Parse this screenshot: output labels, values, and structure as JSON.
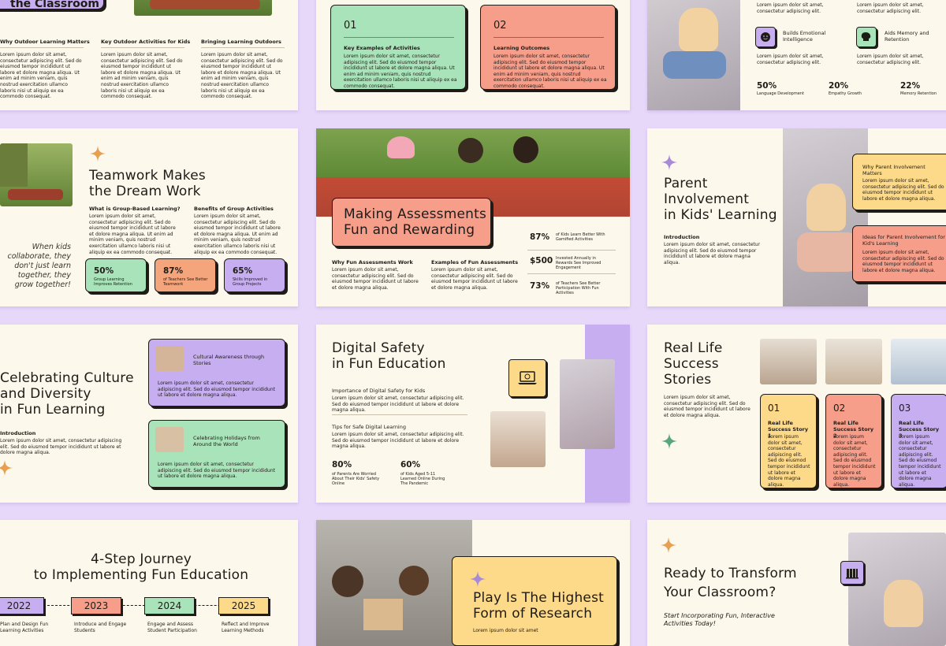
{
  "colors": {
    "purple": "#c6aef0",
    "green": "#a9e3ba",
    "salmon": "#f79e8b",
    "orange": "#f5a57b",
    "yellow": "#fdd98a",
    "cream": "#fcf8ec",
    "bg": "#e7d8fa"
  },
  "icons": [
    "sparkle-icon",
    "laptop-icon",
    "smile-icon",
    "brain-icon",
    "books-icon"
  ],
  "s1": {
    "title": "the Classroom",
    "cols": [
      {
        "h": "Why Outdoor Learning Matters",
        "b": "Lorem ipsum dolor sit amet, consectetur adipiscing elit. Sed do eiusmod tempor incididunt ut labore et dolore magna aliqua. Ut enim ad minim veniam, quis nostrud exercitation ullamco laboris nisi ut aliquip ex ea commodo consequat."
      },
      {
        "h": "Key Outdoor Activities for Kids",
        "b": "Lorem ipsum dolor sit amet, consectetur adipiscing elit. Sed do eiusmod tempor incididunt ut labore et dolore magna aliqua. Ut enim ad minim veniam, quis nostrud exercitation ullamco laboris nisi ut aliquip ex ea commodo consequat."
      },
      {
        "h": "Bringing Learning Outdoors",
        "b": "Lorem ipsum dolor sit amet, consectetur adipiscing elit. Sed do eiusmod tempor incididunt ut labore et dolore magna aliqua. Ut enim ad minim veniam, quis nostrud exercitation ullamco laboris nisi ut aliquip ex ea commodo consequat."
      }
    ]
  },
  "s2": {
    "cards": [
      {
        "num": "01",
        "h": "Key Examples of Activities",
        "b": "Lorem ipsum dolor sit amet, consectetur adipiscing elit. Sed do eiusmod tempor incididunt ut labore et dolore magna aliqua. Ut enim ad minim veniam, quis nostrud exercitation ullamco laboris nisi ut aliquip ex ea commodo consequat."
      },
      {
        "num": "02",
        "h": "Learning Outcomes",
        "b": "Lorem ipsum dolor sit amet, consectetur adipiscing elit. Sed do eiusmod tempor incididunt ut labore et dolore magna aliqua. Ut enim ad minim veniam, quis nostrud exercitation ullamco laboris nisi ut aliquip ex ea commodo consequat."
      }
    ]
  },
  "s3": {
    "top_body": "Lorem ipsum dolor sit amet, consectetur adipiscing elit.",
    "features": [
      {
        "h": "Builds Emotional Intelligence",
        "b": "Lorem ipsum dolor sit amet, consectetur adipiscing elit."
      },
      {
        "h": "Aids Memory and Retention",
        "b": "Lorem ipsum dolor sit amet, consectetur adipiscing elit."
      }
    ],
    "stats": [
      {
        "v": "50%",
        "l": "Language Development"
      },
      {
        "v": "20%",
        "l": "Empathy Growth"
      },
      {
        "v": "22%",
        "l": "Memory Retention"
      }
    ]
  },
  "s4": {
    "title1": "Teamwork Makes",
    "title2": "the Dream Work",
    "cols": [
      {
        "h": "What is Group-Based Learning?",
        "b": "Lorem ipsum dolor sit amet, consectetur adipiscing elit. Sed do eiusmod tempor incididunt ut labore et dolore magna aliqua. Ut enim ad minim veniam, quis nostrud exercitation ullamco laboris nisi ut aliquip ex ea commodo consequat."
      },
      {
        "h": "Benefits of Group Activities",
        "b": "Lorem ipsum dolor sit amet, consectetur adipiscing elit. Sed do eiusmod tempor incididunt ut labore et dolore magna aliqua. Ut enim ad minim veniam, quis nostrud exercitation ullamco laboris nisi ut aliquip ex ea commodo consequat."
      }
    ],
    "quote": [
      "When kids",
      "collaborate, they",
      "don't just learn",
      "together, they",
      "grow together!"
    ],
    "stats": [
      {
        "v": "50%",
        "l": "Group Learning Improves Retention"
      },
      {
        "v": "87%",
        "l": "of Teachers See Better Teamwork"
      },
      {
        "v": "65%",
        "l": "Skills Improved in Group Projects"
      }
    ]
  },
  "s5": {
    "title1": "Making Assessments",
    "title2": "Fun and Rewarding",
    "cols": [
      {
        "h": "Why Fun Assessments Work",
        "b": "Lorem ipsum dolor sit amet, consectetur adipiscing elit. Sed do eiusmod tempor incididunt ut labore et dolore magna aliqua."
      },
      {
        "h": "Examples of Fun Assessments",
        "b": "Lorem ipsum dolor sit amet, consectetur adipiscing elit. Sed do eiusmod tempor incididunt ut labore et dolore magna aliqua."
      }
    ],
    "stats": [
      {
        "v": "87%",
        "l": "of Kids Learn Better With Gamified Activities"
      },
      {
        "v": "$500",
        "l": "Invested Annually in Rewards See Improved Engagement"
      },
      {
        "v": "73%",
        "l": "of Teachers See Better Participation With Fun Activities"
      }
    ]
  },
  "s6": {
    "title1": "Parent",
    "title2": "Involvement",
    "title3": "in Kids' Learning",
    "intro_h": "Introduction",
    "intro_b": "Lorem ipsum dolor sit amet, consectetur adipiscing elit. Sed do eiusmod tempor incididunt ut labore et dolore magna aliqua.",
    "cards": [
      {
        "h": "Why Parent Involvement Matters",
        "b": "Lorem ipsum dolor sit amet, consectetur adipiscing elit. Sed do eiusmod tempor incididunt ut labore et dolore magna aliqua."
      },
      {
        "h": "Ideas for Parent Involvement for Kid's Learning",
        "b": "Lorem ipsum dolor sit amet, consectetur adipiscing elit. Sed do eiusmod tempor incididunt ut labore et dolore magna aliqua."
      }
    ]
  },
  "s7": {
    "title1": "Celebrating Culture",
    "title2": "and Diversity",
    "title3": "in Fun Learning",
    "intro_h": "Introduction",
    "intro_b": "Lorem ipsum dolor sit amet, consectetur adipiscing elit. Sed do eiusmod tempor incididunt ut labore et dolore magna aliqua.",
    "cards": [
      {
        "h": "Cultural Awareness through Stories",
        "b": "Lorem ipsum dolor sit amet, consectetur adipiscing elit. Sed do eiusmod tempor incididunt ut labore et dolore magna aliqua."
      },
      {
        "h": "Celebrating Holidays from Around the World",
        "b": "Lorem ipsum dolor sit amet, consectetur adipiscing elit. Sed do eiusmod tempor incididunt ut labore et dolore magna aliqua."
      }
    ]
  },
  "s8": {
    "title1": "Digital Safety",
    "title2": "in Fun Education",
    "items": [
      {
        "h": "Importance of Digital Safety for Kids",
        "b": "Lorem ipsum dolor sit amet, consectetur adipiscing elit. Sed do eiusmod tempor incididunt ut labore et dolore magna aliqua."
      },
      {
        "h": "Tips for Safe Digital Learning",
        "b": "Lorem ipsum dolor sit amet, consectetur adipiscing elit. Sed do eiusmod tempor incididunt ut labore et dolore magna aliqua."
      }
    ],
    "stats": [
      {
        "v": "80%",
        "l": "of Parents Are Worried About Their Kids' Safety Online"
      },
      {
        "v": "60%",
        "l": "of Kids Aged 5-11 Learned Online During The Pandemic"
      }
    ]
  },
  "s9": {
    "title1": "Real Life",
    "title2": "Success",
    "title3": "Stories",
    "body": "Lorem ipsum dolor sit amet, consectetur adipiscing elit. Sed do eiusmod tempor incididunt ut labore et dolore magna aliqua.",
    "cards": [
      {
        "num": "01",
        "h": "Real Life Success Story 1",
        "b": "Lorem ipsum dolor sit amet, consectetur adipiscing elit. Sed do eiusmod tempor incididunt ut labore et dolore magna aliqua."
      },
      {
        "num": "02",
        "h": "Real Life Success Story 2",
        "b": "Lorem ipsum dolor sit amet, consectetur adipiscing elit. Sed do eiusmod tempor incididunt ut labore et dolore magna aliqua."
      },
      {
        "num": "03",
        "h": "Real Life Success Story 3",
        "b": "Lorem ipsum dolor sit amet, consectetur adipiscing elit. Sed do eiusmod tempor incididunt ut labore et dolore magna aliqua."
      }
    ]
  },
  "s10": {
    "title1": "4-Step Journey",
    "title2": "to Implementing Fun Education",
    "steps": [
      {
        "y": "2022",
        "t": "Plan and Design Fun Learning Activities"
      },
      {
        "y": "2023",
        "t": "Introduce and Engage Students"
      },
      {
        "y": "2024",
        "t": "Engage and Assess Student Participation"
      },
      {
        "y": "2025",
        "t": "Reflect and Improve Learning Methods"
      }
    ]
  },
  "s11": {
    "title1": "Play Is The Highest",
    "title2": "Form of Research",
    "body": "Lorem ipsum dolor sit amet"
  },
  "s12": {
    "title1": "Ready to Transform",
    "title2": "Your Classroom?",
    "sub": "Start Incorporating Fun, Interactive Activities Today!"
  }
}
